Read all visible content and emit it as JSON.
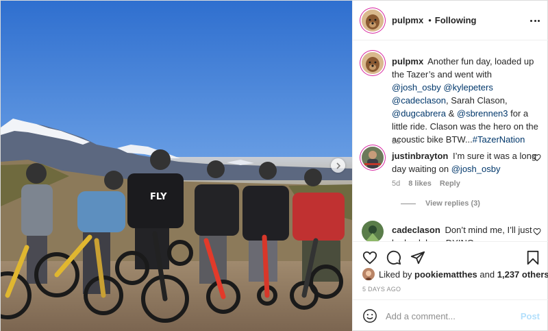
{
  "header": {
    "username": "pulpmx",
    "dot": "•",
    "follow_status": "Following"
  },
  "caption": {
    "username": "pulpmx",
    "parts": {
      "t1": "Another fun day, loaded up the Tazer’s and went with ",
      "m1": "@josh_osby",
      "t2": " ",
      "m2": "@kylepeters",
      "t3": " ",
      "m3": "@cadeclason",
      "t4": ", Sarah Clason, ",
      "m4": "@dugcabrera",
      "t5": " & ",
      "m5": "@sbrennen3",
      "t6": " for a little ride. Clason was the hero on the acoustic bike BTW...",
      "m6": "#TazerNation"
    },
    "time": "5d"
  },
  "comments": [
    {
      "username": "justinbrayton",
      "text": "I’m sure it was a long day waiting on ",
      "mention": "@josh_osby",
      "time": "5d",
      "likes": "8 likes",
      "reply": "Reply",
      "view_replies": "View replies (3)"
    },
    {
      "username": "cadeclason",
      "text": "Don’t mind me, I’ll just be back here DYING"
    }
  ],
  "actions": {
    "liked_by_prefix": "Liked by",
    "liked_by_user": "pookiematthes",
    "and": "and",
    "others": "1,237 others",
    "time_ago": "5 DAYS AGO"
  },
  "add_comment": {
    "placeholder": "Add a comment...",
    "post_label": "Post"
  },
  "icons": {
    "heart": "heart-icon",
    "comment": "comment-icon",
    "share": "share-icon",
    "save": "bookmark-icon",
    "emoji": "emoji-icon",
    "more": "more-icon",
    "next": "chevron-right-icon"
  },
  "colors": {
    "mention": "#00376b",
    "muted": "#8e8e8e",
    "post_disabled": "#b2dffc",
    "story_ring": "#d6249f"
  }
}
